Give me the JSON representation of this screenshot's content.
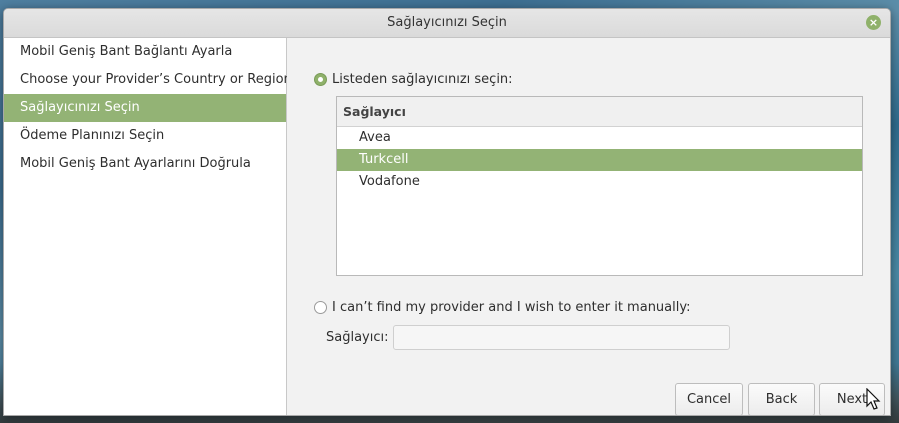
{
  "window": {
    "title": "Sağlayıcınızı Seçin",
    "close_symbol": "×"
  },
  "sidebar": {
    "steps": [
      {
        "label": "Mobil Geniş Bant Bağlantı Ayarla",
        "active": false
      },
      {
        "label": "Choose your Provider’s Country or Region",
        "active": false
      },
      {
        "label": "Sağlayıcınızı Seçin",
        "active": true
      },
      {
        "label": "Ödeme Planınızı Seçin",
        "active": false
      },
      {
        "label": "Mobil Geniş Bant Ayarlarını Doğrula",
        "active": false
      }
    ]
  },
  "main": {
    "list_option": {
      "label": "Listeden sağlayıcınızı seçin:",
      "checked": true
    },
    "provider_list": {
      "header": "Sağlayıcı",
      "items": [
        {
          "label": "Avea",
          "selected": false
        },
        {
          "label": "Turkcell",
          "selected": true
        },
        {
          "label": "Vodafone",
          "selected": false
        }
      ]
    },
    "manual_option": {
      "label": "I can’t find my provider and I wish to enter it manually:",
      "checked": false
    },
    "manual_field": {
      "label": "Sağlayıcı:",
      "value": "",
      "placeholder": ""
    }
  },
  "buttons": {
    "cancel": "Cancel",
    "back": "Back",
    "next": "Next"
  },
  "colors": {
    "accent": "#93b375",
    "window_bg": "#f2f2f2"
  }
}
